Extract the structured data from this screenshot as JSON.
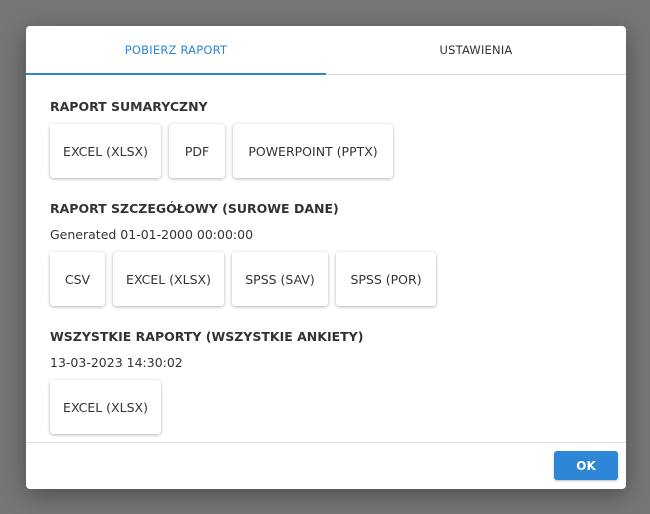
{
  "tabs": [
    {
      "label": "POBIERZ RAPORT",
      "active": true
    },
    {
      "label": "USTAWIENIA",
      "active": false
    }
  ],
  "sections": {
    "summary": {
      "title": "RAPORT SUMARYCZNY",
      "buttons": [
        "EXCEL (XLSX)",
        "PDF",
        "POWERPOINT (PPTX)"
      ]
    },
    "detailed": {
      "title": "RAPORT SZCZEGÓŁOWY (SUROWE DANE)",
      "generated": "Generated 01-01-2000 00:00:00",
      "buttons": [
        "CSV",
        "EXCEL (XLSX)",
        "SPSS (SAV)",
        "SPSS (POR)"
      ]
    },
    "all": {
      "title": "WSZYSTKIE RAPORTY (WSZYSTKIE ANKIETY)",
      "generated": "13-03-2023 14:30:02",
      "buttons": [
        "EXCEL (XLSX)"
      ]
    }
  },
  "footer": {
    "ok_label": "OK"
  },
  "colors": {
    "accent": "#2d86d6",
    "overlay": "#767676",
    "text": "#333333"
  }
}
